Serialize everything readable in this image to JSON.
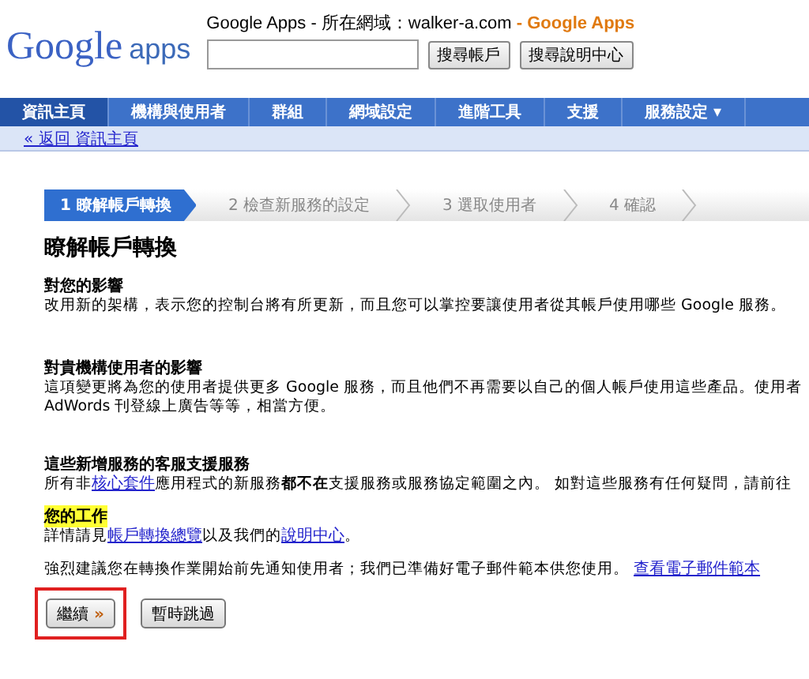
{
  "header": {
    "logo": {
      "word": "Google",
      "suffix": "apps"
    },
    "title": "Google Apps - 所在網域：walker-a.com",
    "title_brand": "- Google Apps",
    "buttons": [
      "搜尋帳戶",
      "搜尋說明中心"
    ]
  },
  "nav": {
    "tabs": [
      {
        "label": "資訊主頁",
        "selected": true
      },
      {
        "label": "機構與使用者",
        "selected": false
      },
      {
        "label": "群組",
        "selected": false
      },
      {
        "label": "網域設定",
        "selected": false
      },
      {
        "label": "進階工具",
        "selected": false
      },
      {
        "label": "支援",
        "selected": false
      },
      {
        "label": "服務設定 ▾",
        "selected": false
      }
    ],
    "back_link": "« 返回 資訊主頁"
  },
  "steps": [
    {
      "label": "1 瞭解帳戶轉換",
      "selected": true
    },
    {
      "label": "2 檢查新服務的設定",
      "selected": false
    },
    {
      "label": "3 選取使用者",
      "selected": false
    },
    {
      "label": "4 確認",
      "selected": false
    }
  ],
  "heading": "瞭解帳戶轉換",
  "sections": [
    {
      "title": "對您的影響",
      "highlighted": false,
      "paragraphs": [
        [
          {
            "kind": "text",
            "text": "改用新的架構，表示您的控制台將有所更新，而且您可以掌控要讓使用者從其帳戶使用哪些 Google 服務。"
          }
        ]
      ]
    },
    {
      "title": "對貴機構使用者的影響",
      "highlighted": false,
      "paragraphs": [
        [
          {
            "kind": "text",
            "text": "這項變更將為您的使用者提供更多 Google 服務，而且他們不再需要以自己的個人帳戶使用這些產品。使用者"
          }
        ],
        [
          {
            "kind": "text",
            "text": "AdWords 刊登線上廣告等等，相當方便。"
          }
        ]
      ]
    },
    {
      "title": "這些新增服務的客服支援服務",
      "highlighted": false,
      "paragraphs": [
        [
          {
            "kind": "text",
            "text": "所有非"
          },
          {
            "kind": "link",
            "text": "核心套件"
          },
          {
            "kind": "text",
            "text": "應用程式的新服務"
          },
          {
            "kind": "bold",
            "text": "都不在"
          },
          {
            "kind": "text",
            "text": "支援服務或服務協定範圍之內。 如對這些服務有任何疑問，請前往"
          }
        ]
      ]
    },
    {
      "title": "您的工作",
      "highlighted": true,
      "paragraphs": [
        [
          {
            "kind": "text",
            "text": "詳情請見"
          },
          {
            "kind": "link",
            "text": "帳戶轉換總覽"
          },
          {
            "kind": "text",
            "text": "以及我們的"
          },
          {
            "kind": "link",
            "text": "說明中心"
          },
          {
            "kind": "text",
            "text": "。"
          }
        ]
      ]
    }
  ],
  "notice": [
    {
      "kind": "text",
      "text": "強烈建議您在轉換作業開始前先通知使用者；我們已準備好電子郵件範本供您使用。 "
    },
    {
      "kind": "link",
      "text": "查看電子郵件範本"
    }
  ],
  "actions": [
    {
      "label": "繼續",
      "arrow": "»",
      "highlighted": true
    },
    {
      "label": "暫時跳過",
      "highlighted": false
    }
  ]
}
